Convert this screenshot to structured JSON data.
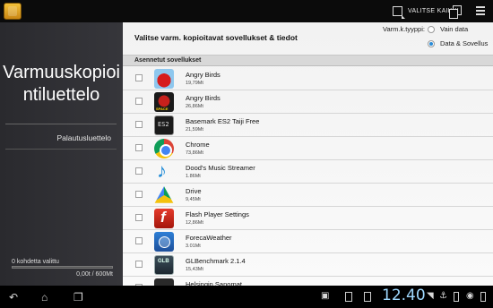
{
  "topbar": {
    "select_all_label": "VALITSE KAIKKI",
    "icons": [
      "app-icon",
      "select-all-icon",
      "copy-icon",
      "menu-icon"
    ]
  },
  "sidebar": {
    "title": "Varmuuskopiointiluettelo",
    "restore_link": "Palautusluettelo",
    "selected_count": "0 kohdetta valittu",
    "size_summary": "0,00t / 600Mt",
    "progress": 0.0
  },
  "main": {
    "title": "Valitse varm. kopioitavat sovellukset & tiedot",
    "backup_type": {
      "label": "Varm.k.tyyppi:",
      "options": [
        {
          "label": "Vain data",
          "selected": false
        },
        {
          "label": "Data & Sovellus",
          "selected": true
        }
      ]
    },
    "section_header": "Asennetut sovellukset",
    "apps": [
      {
        "name": "Angry Birds",
        "size": "19,79Mt",
        "icon": "angry-birds-icon",
        "checked": false
      },
      {
        "name": "Angry Birds",
        "size": "26,86Mt",
        "icon": "angry-birds-space-icon",
        "checked": false
      },
      {
        "name": "Basemark ES2 Taiji Free",
        "size": "21,59Mt",
        "icon": "basemark-icon",
        "checked": false
      },
      {
        "name": "Chrome",
        "size": "73,86Mt",
        "icon": "chrome-icon",
        "checked": false
      },
      {
        "name": "Dood's Music Streamer",
        "size": "1.86Mt",
        "icon": "music-note-icon",
        "checked": false
      },
      {
        "name": "Drive",
        "size": "9,45Mt",
        "icon": "drive-icon",
        "checked": false
      },
      {
        "name": "Flash Player Settings",
        "size": "12,86Mt",
        "icon": "flash-icon",
        "checked": false
      },
      {
        "name": "ForecaWeather",
        "size": "3.01Mt",
        "icon": "weather-icon",
        "checked": false
      },
      {
        "name": "GLBenchmark 2.1.4",
        "size": "15,43Mt",
        "icon": "glbenchmark-icon",
        "checked": false
      },
      {
        "name": "Helsingin Sanomat",
        "size": "",
        "icon": "helsingin-sanomat-icon",
        "checked": false
      }
    ]
  },
  "statusbar": {
    "clock": "12.40"
  }
}
